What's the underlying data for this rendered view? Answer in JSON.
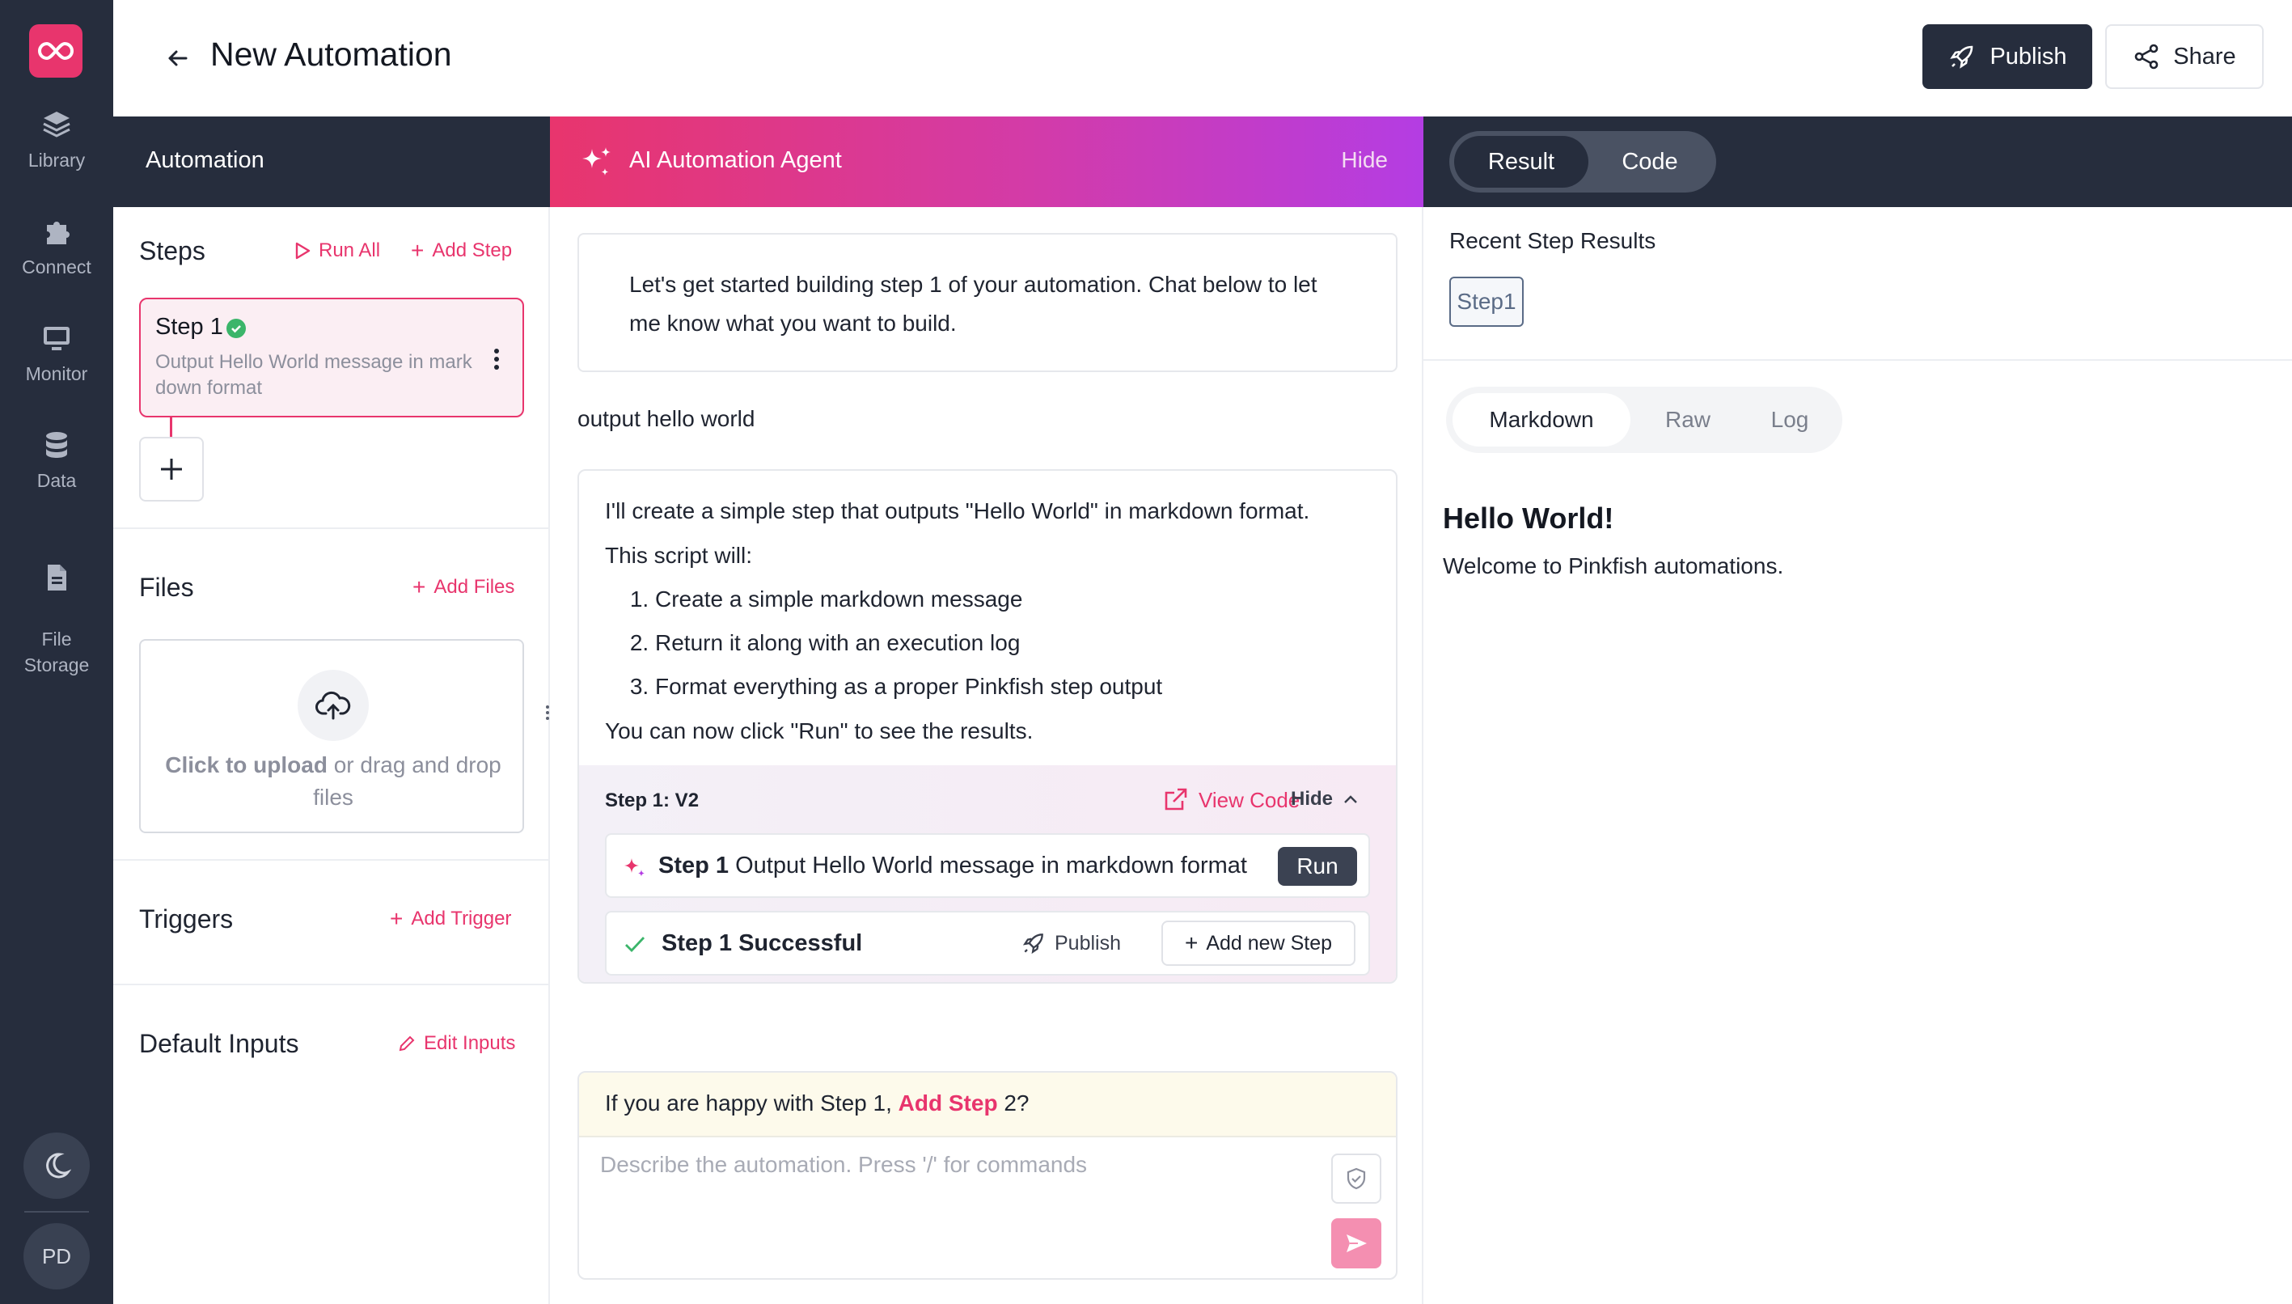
{
  "nav": {
    "items": [
      {
        "label": "Library",
        "icon": "layers-icon"
      },
      {
        "label": "Connect",
        "icon": "puzzle-icon"
      },
      {
        "label": "Monitor",
        "icon": "monitor-icon"
      },
      {
        "label": "Data",
        "icon": "database-icon"
      },
      {
        "label": "File\nStorage",
        "icon": "file-icon"
      }
    ],
    "theme_icon": "moon-icon",
    "user_initials": "PD"
  },
  "header": {
    "title": "New Automation",
    "publish_label": "Publish",
    "share_label": "Share"
  },
  "automation_panel": {
    "title": "Automation",
    "steps": {
      "title": "Steps",
      "run_all": "Run All",
      "add_step": "Add Step",
      "items": [
        {
          "name": "Step 1",
          "description": "Output Hello World message in markdown format",
          "status": "success"
        }
      ]
    },
    "files": {
      "title": "Files",
      "add": "Add Files",
      "upload_strong": "Click to upload",
      "upload_rest": " or drag and drop files"
    },
    "triggers": {
      "title": "Triggers",
      "add": "Add Trigger"
    },
    "default_inputs": {
      "title": "Default Inputs",
      "edit": "Edit Inputs"
    }
  },
  "agent": {
    "title": "AI Automation Agent",
    "hide": "Hide",
    "intro": "Let's get started building step 1 of your automation. Chat below to let me know what you want to build.",
    "user_message": "output hello world",
    "reply": {
      "line1": "I'll create a simple step that outputs \"Hello World\" in markdown format.",
      "line2": "This script will:",
      "list": [
        "Create a simple markdown message",
        "Return it along with an execution log",
        "Format everything as a proper Pinkfish step output"
      ],
      "line3": "You can now click \"Run\" to see the results."
    },
    "version_card": {
      "version": "Step 1: V2",
      "view_code": "View Code",
      "hide": "Hide",
      "step_bold": "Step 1",
      "step_desc": " Output Hello World message in markdown format",
      "run": "Run",
      "success": "Step 1 Successful",
      "publish": "Publish",
      "add_new": "Add new Step"
    },
    "prompt": {
      "pre": "If you are happy with Step 1, ",
      "link": "Add Step",
      "post": " 2?",
      "placeholder": "Describe the automation. Press '/' for commands"
    },
    "colors": {
      "accent": "#e8356d",
      "gradient_end": "#b43de3"
    }
  },
  "result_panel": {
    "tabs": [
      "Result",
      "Code"
    ],
    "active_tab": "Result",
    "recent_label": "Recent Step Results",
    "chips": [
      "Step1"
    ],
    "view_tabs": [
      "Markdown",
      "Raw",
      "Log"
    ],
    "active_view": "Markdown",
    "output": {
      "heading": "Hello World!",
      "text": "Welcome to Pinkfish automations."
    }
  }
}
